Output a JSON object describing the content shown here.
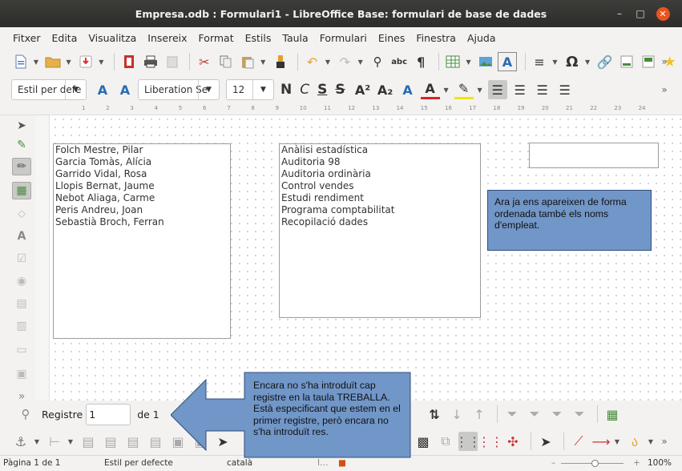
{
  "window": {
    "title": "Empresa.odb : Formulari1 - LibreOffice Base: formulari de base de dades",
    "minimize": "–",
    "maximize": "□",
    "close": "✕"
  },
  "menu": [
    "Fitxer",
    "Edita",
    "Visualitza",
    "Insereix",
    "Format",
    "Estils",
    "Taula",
    "Formulari",
    "Eines",
    "Finestra",
    "Ajuda"
  ],
  "formatting": {
    "style": "Estil per defe",
    "font": "Liberation Se",
    "size": "12",
    "bold": "N",
    "italic": "C",
    "underline": "S",
    "strike": "S"
  },
  "ruler_numbers": [
    "1",
    "2",
    "3",
    "4",
    "5",
    "6",
    "7",
    "8",
    "9",
    "10",
    "11",
    "12",
    "13",
    "14",
    "15",
    "16",
    "17",
    "18",
    "19",
    "20",
    "21",
    "22",
    "23",
    "24"
  ],
  "form": {
    "employees": [
      "Folch Mestre, Pilar",
      "Garcia Tomàs, Alícia",
      "Garrido Vidal, Rosa",
      "Llopis Bernat, Jaume",
      "Nebot Aliaga, Carme",
      "Peris Andreu, Joan",
      "Sebastià Broch, Ferran"
    ],
    "tasks": [
      "Anàlisi estadística",
      "Auditoria 98",
      "Auditoria ordinària",
      "Control vendes",
      "Estudi rendiment",
      "Programa comptabilitat",
      "Recopilació dades"
    ]
  },
  "annotations": {
    "note1": "Ara ja ens apareixen de forma ordenada també els noms d'empleat.",
    "note2": "Encara no s'ha introduït cap registre en la taula TREBALLA. Està especificant que estem en el primer registre, però encara no s'ha introduït res."
  },
  "navigation": {
    "record_label": "Registre",
    "record_value": "1",
    "of_label": "de 1"
  },
  "status": {
    "page": "Pàgina 1 de 1",
    "style": "Estil per defecte",
    "language": "català",
    "zoom": "100%"
  }
}
